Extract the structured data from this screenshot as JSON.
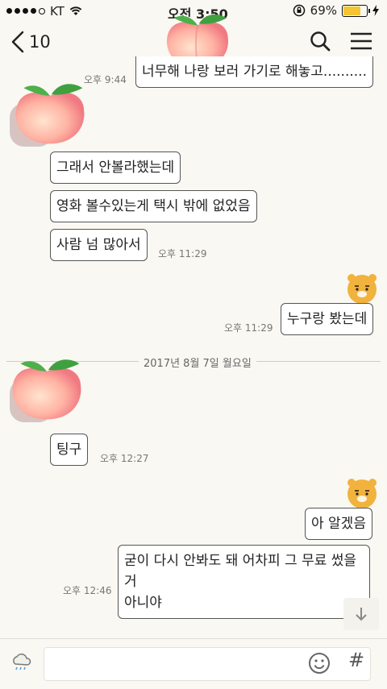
{
  "status_bar": {
    "carrier": "KT",
    "time": "오전 3:50",
    "battery": "69%",
    "battery_level": 0.69
  },
  "header": {
    "unread_count": "10"
  },
  "messages": [
    {
      "text": "너무해 나랑 보러 가기로 해놓고..........",
      "time": "오후 9:44"
    },
    {
      "text": "그래서 안볼라했는데"
    },
    {
      "text": "영화 볼수있는게 택시 밖에 없었음"
    },
    {
      "text": "사람 넘 많아서",
      "time": "오후 11:29"
    },
    {
      "text": "누구랑 봤는데",
      "time": "오후 11:29"
    },
    {
      "text": "팅구",
      "time": "오후 12:27"
    },
    {
      "text": "아 알겠음"
    },
    {
      "text": "굳이 다시 안봐도 돼 어차피 그 무료 썼을거\n아니야",
      "time": "오후 12:46"
    }
  ],
  "date_divider": "2017년 8월 7일 월요일",
  "colors": {
    "background": "#f9f8f2",
    "bubble_border": "#555555",
    "battery": "#f4c531"
  },
  "icons": [
    "back-chevron-icon",
    "search-icon",
    "menu-icon",
    "peach-emoji",
    "ryan-avatar",
    "emoji-icon",
    "weather-icon",
    "arrow-down-icon"
  ]
}
